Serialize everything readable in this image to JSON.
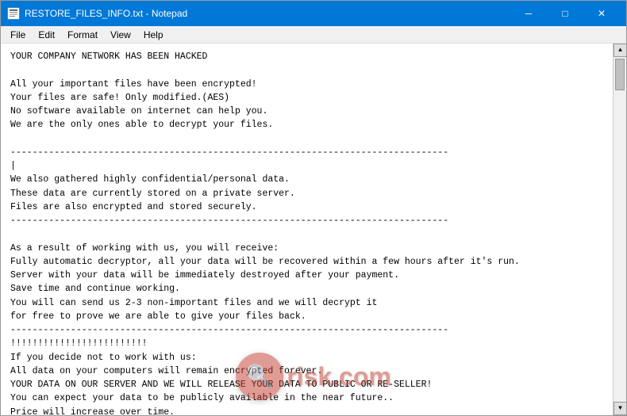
{
  "titleBar": {
    "icon": "📄",
    "title": "RESTORE_FILES_INFO.txt - Notepad",
    "minimizeLabel": "─",
    "maximizeLabel": "□",
    "closeLabel": "✕"
  },
  "menuBar": {
    "items": [
      "File",
      "Edit",
      "Format",
      "View",
      "Help"
    ]
  },
  "content": "YOUR COMPANY NETWORK HAS BEEN HACKED\n\nAll your important files have been encrypted!\nYour files are safe! Only modified.(AES)\nNo software available on internet can help you.\nWe are the only ones able to decrypt your files.\n\n--------------------------------------------------------------------------------\n|\nWe also gathered highly confidential/personal data.\nThese data are currently stored on a private server.\nFiles are also encrypted and stored securely.\n--------------------------------------------------------------------------------\n\nAs a result of working with us, you will receive:\nFully automatic decryptor, all your data will be recovered within a few hours after it's run.\nServer with your data will be immediately destroyed after your payment.\nSave time and continue working.\nYou will can send us 2-3 non-important files and we will decrypt it\nfor free to prove we are able to give your files back.\n--------------------------------------------------------------------------------\n!!!!!!!!!!!!!!!!!!!!!!!!!\nIf you decide not to work with us:\nAll data on your computers will remain encrypted forever.\nYOUR DATA ON OUR SERVER AND WE WILL RELEASE YOUR DATA TO PUBLIC OR RE-SELLER!\nYou can expect your data to be publicly available in the near future..\nPrice will increase over time.\nDO NOT!!!!!!!!!!!!!!!!!!",
  "watermark": {
    "iconText": "🔍",
    "text": "risk.com"
  }
}
